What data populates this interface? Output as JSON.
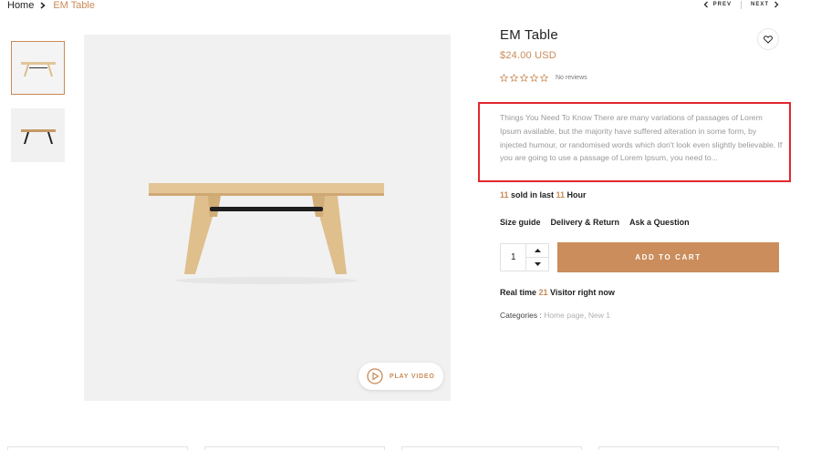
{
  "breadcrumb": {
    "home": "Home",
    "current": "EM Table"
  },
  "pager": {
    "prev": "PREV",
    "next": "NEXT"
  },
  "gallery": {
    "thumbnails": [
      "table-front-thumb",
      "table-dark-thumb"
    ],
    "play_video_label": "PLAY VIDEO"
  },
  "product": {
    "title": "EM Table",
    "price": "$24.00 USD",
    "rating_stars": 0,
    "rating_max": 5,
    "reviews_label": "No reviews",
    "description": "Things You Need To Know There are many variations of passages of Lorem Ipsum available, but the majority have suffered alteration in some form, by injected humour, or randomised words which don't look even slightly believable. If you are going to use a passage of Lorem Ipsum, you need to...",
    "sold": {
      "count": "11",
      "middle": " sold in last ",
      "hours": "11",
      "suffix": " Hour"
    },
    "links": {
      "size_guide": "Size guide",
      "delivery_return": "Delivery & Return",
      "ask_question": "Ask a Question"
    },
    "quantity": "1",
    "add_to_cart": "ADD TO CART",
    "realtime": {
      "prefix": "Real time ",
      "count": "21",
      "suffix": " Visitor right now"
    },
    "categories": {
      "label": "Categories :",
      "values": "Home page, New 1"
    }
  },
  "colors": {
    "accent": "#c98a55",
    "button": "#ca8d5b",
    "highlight_box": "#e3262c"
  }
}
